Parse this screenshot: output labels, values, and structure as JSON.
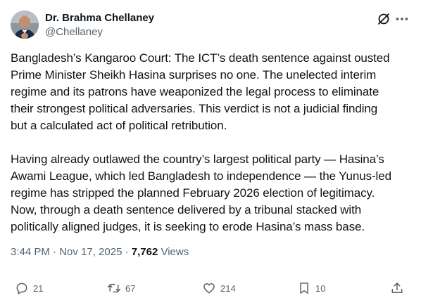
{
  "author": {
    "name": "Dr. Brahma Chellaney",
    "handle": "@Chellaney",
    "avatar_icon": "profile-photo"
  },
  "post": {
    "text": "Bangladesh’s Kangaroo Court: The ICT’s death sentence against ousted\nPrime Minister Sheikh Hasina surprises no one. The unelected interim\nregime and its patrons have weaponized the legal process to eliminate\ntheir strongest political adversaries. This verdict is not a judicial finding\nbut a calculated act of political retribution.\n\nHaving already outlawed the country’s largest political party — Hasina’s\nAwami League, which led Bangladesh to independence — the Yunus-led\nregime has stripped the planned February 2026 election of legitimacy.\nNow, through a death sentence delivered by a tribunal stacked with\npolitically aligned judges, it is seeking to erode Hasina’s mass base.",
    "timestamp": "3:44 PM · Nov 17, 2025",
    "separator": " · ",
    "views_count": "7,762",
    "views_label": " Views"
  },
  "actions": {
    "replies": "21",
    "reposts": "67",
    "likes": "214",
    "bookmarks": "10"
  },
  "colors": {
    "text": "#0f1419",
    "secondary": "#536471"
  }
}
